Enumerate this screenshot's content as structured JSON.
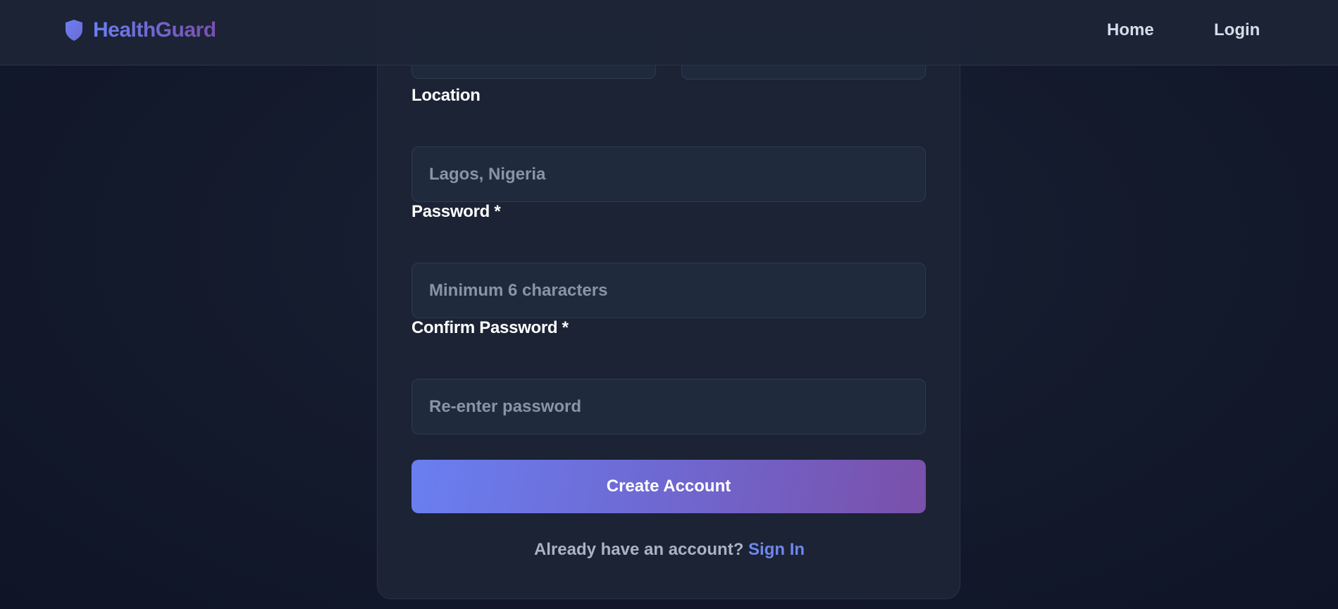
{
  "header": {
    "brand_name": "HealthGuard",
    "nav": {
      "home": "Home",
      "login": "Login"
    }
  },
  "form": {
    "location": {
      "label": "Location",
      "placeholder": "Lagos, Nigeria"
    },
    "password": {
      "label": "Password *",
      "placeholder": "Minimum 6 characters"
    },
    "confirm_password": {
      "label": "Confirm Password *",
      "placeholder": "Re-enter password"
    },
    "submit_label": "Create Account",
    "signin_prompt": "Already have an account?",
    "signin_link": "Sign In"
  },
  "colors": {
    "accent_start": "#6a7ff0",
    "accent_end": "#7a4fae",
    "background": "#141b2d",
    "card": "#1b2334"
  },
  "icons": {
    "brand": "shield-icon"
  }
}
